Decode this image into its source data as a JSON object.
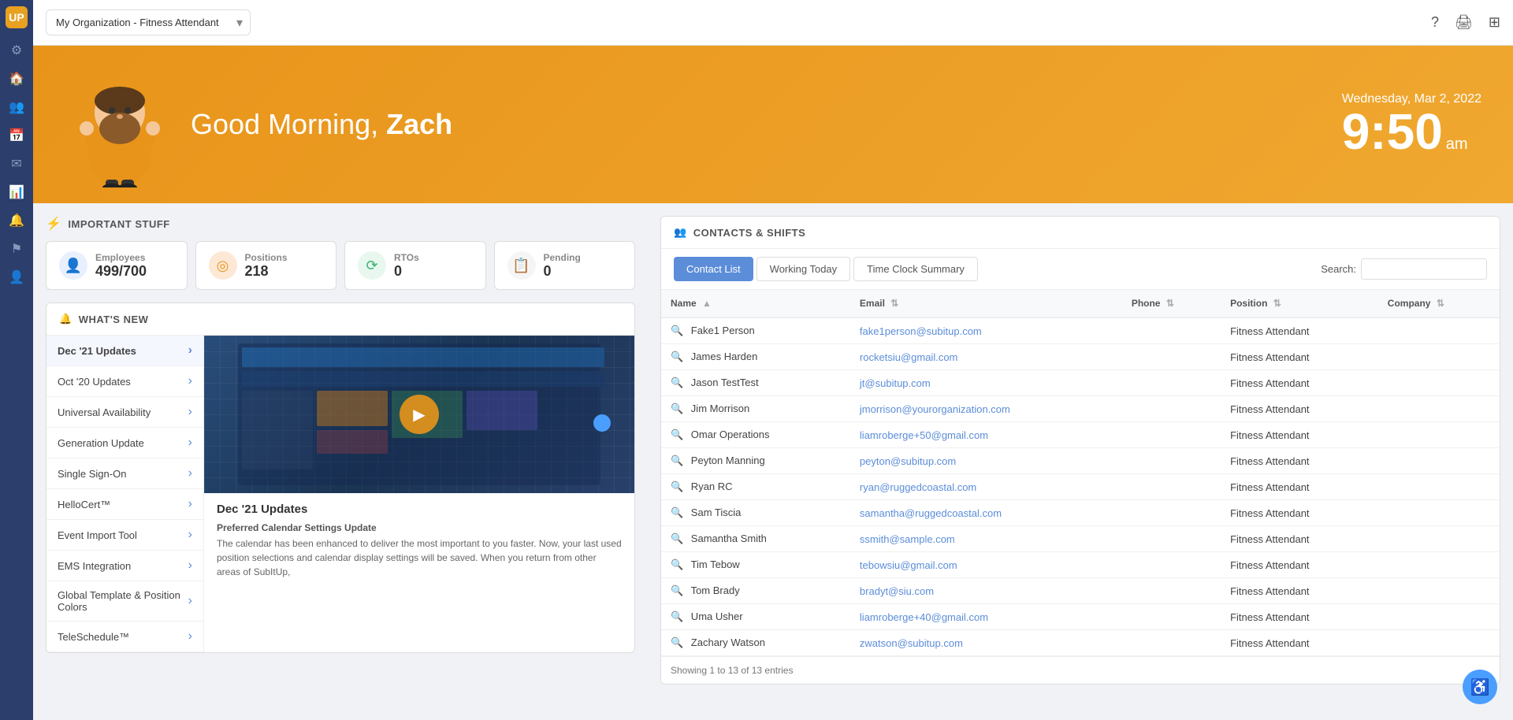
{
  "app": {
    "logo": "UP",
    "title": "My Organization - Fitness Attendant"
  },
  "topbar": {
    "org_selector_value": "My Organization - Fitness Attendant",
    "icons": [
      "question-circle",
      "printer",
      "grid"
    ]
  },
  "hero": {
    "greeting": "Good Morning, ",
    "name": "Zach",
    "date": "Wednesday, Mar 2, 2022",
    "time": "9:50",
    "ampm": "am"
  },
  "important_stuff": {
    "label": "IMPORTANT STUFF",
    "stats": [
      {
        "id": "employees",
        "label": "Employees",
        "value": "499/700",
        "icon": "👤"
      },
      {
        "id": "positions",
        "label": "Positions",
        "value": "218",
        "icon": "◎"
      },
      {
        "id": "rtos",
        "label": "RTOs",
        "value": "0",
        "icon": "⟳"
      },
      {
        "id": "pending",
        "label": "Pending",
        "value": "0",
        "icon": "📋"
      }
    ]
  },
  "whats_new": {
    "label": "WHAT'S NEW",
    "items": [
      {
        "id": "dec21",
        "label": "Dec '21 Updates",
        "has_arrow": true,
        "active": true
      },
      {
        "id": "oct20",
        "label": "Oct '20 Updates",
        "has_arrow": true
      },
      {
        "id": "universal",
        "label": "Universal Availability",
        "has_arrow": true
      },
      {
        "id": "generation",
        "label": "Generation Update",
        "has_arrow": true
      },
      {
        "id": "sso",
        "label": "Single Sign-On",
        "has_arrow": true
      },
      {
        "id": "hellocert",
        "label": "HelloCert™",
        "has_arrow": true
      },
      {
        "id": "event_import",
        "label": "Event Import Tool",
        "has_arrow": true
      },
      {
        "id": "ems",
        "label": "EMS Integration",
        "has_arrow": true
      },
      {
        "id": "global_template",
        "label": "Global Template & Position Colors",
        "has_arrow": true
      },
      {
        "id": "teleschedule",
        "label": "TeleSchedule™",
        "has_arrow": true
      }
    ],
    "featured": {
      "title": "Dec '21 Updates",
      "subheading": "Preferred Calendar Settings Update",
      "description": "The calendar has been enhanced to deliver the most important to you faster. Now, your last used position selections and calendar display settings will be saved. When you return from other areas of SubItUp,"
    }
  },
  "contacts": {
    "section_label": "CONTACTS & SHIFTS",
    "tabs": [
      {
        "id": "contact-list",
        "label": "Contact List",
        "active": true
      },
      {
        "id": "working-today",
        "label": "Working Today",
        "active": false
      },
      {
        "id": "time-clock-summary",
        "label": "Time Clock Summary",
        "active": false
      }
    ],
    "search_label": "Search:",
    "search_placeholder": "",
    "table": {
      "columns": [
        {
          "id": "name",
          "label": "Name"
        },
        {
          "id": "email",
          "label": "Email"
        },
        {
          "id": "phone",
          "label": "Phone"
        },
        {
          "id": "position",
          "label": "Position"
        },
        {
          "id": "company",
          "label": "Company"
        }
      ],
      "rows": [
        {
          "name": "Fake1 Person",
          "email": "fake1person@subitup.com",
          "phone": "",
          "position": "Fitness Attendant",
          "company": ""
        },
        {
          "name": "James Harden",
          "email": "rocketsiu@gmail.com",
          "phone": "",
          "position": "Fitness Attendant",
          "company": ""
        },
        {
          "name": "Jason TestTest",
          "email": "jt@subitup.com",
          "phone": "",
          "position": "Fitness Attendant",
          "company": ""
        },
        {
          "name": "Jim Morrison",
          "email": "jmorrison@yourorganization.com",
          "phone": "",
          "position": "Fitness Attendant",
          "company": ""
        },
        {
          "name": "Omar Operations",
          "email": "liamroberge+50@gmail.com",
          "phone": "",
          "position": "Fitness Attendant",
          "company": ""
        },
        {
          "name": "Peyton Manning",
          "email": "peyton@subitup.com",
          "phone": "",
          "position": "Fitness Attendant",
          "company": ""
        },
        {
          "name": "Ryan RC",
          "email": "ryan@ruggedcoastal.com",
          "phone": "",
          "position": "Fitness Attendant",
          "company": ""
        },
        {
          "name": "Sam Tiscia",
          "email": "samantha@ruggedcoastal.com",
          "phone": "",
          "position": "Fitness Attendant",
          "company": ""
        },
        {
          "name": "Samantha Smith",
          "email": "ssmith@sample.com",
          "phone": "",
          "position": "Fitness Attendant",
          "company": ""
        },
        {
          "name": "Tim Tebow",
          "email": "tebowsiu@gmail.com",
          "phone": "",
          "position": "Fitness Attendant",
          "company": ""
        },
        {
          "name": "Tom Brady",
          "email": "bradyt@siu.com",
          "phone": "",
          "position": "Fitness Attendant",
          "company": ""
        },
        {
          "name": "Uma Usher",
          "email": "liamroberge+40@gmail.com",
          "phone": "",
          "position": "Fitness Attendant",
          "company": ""
        },
        {
          "name": "Zachary Watson",
          "email": "zwatson@subitup.com",
          "phone": "",
          "position": "Fitness Attendant",
          "company": ""
        }
      ],
      "footer": "Showing 1 to 13 of 13 entries"
    }
  },
  "sidebar": {
    "icons": [
      "⚙",
      "🏠",
      "👥",
      "📅",
      "✉",
      "📊",
      "🔔",
      "⚑",
      "👤"
    ]
  }
}
